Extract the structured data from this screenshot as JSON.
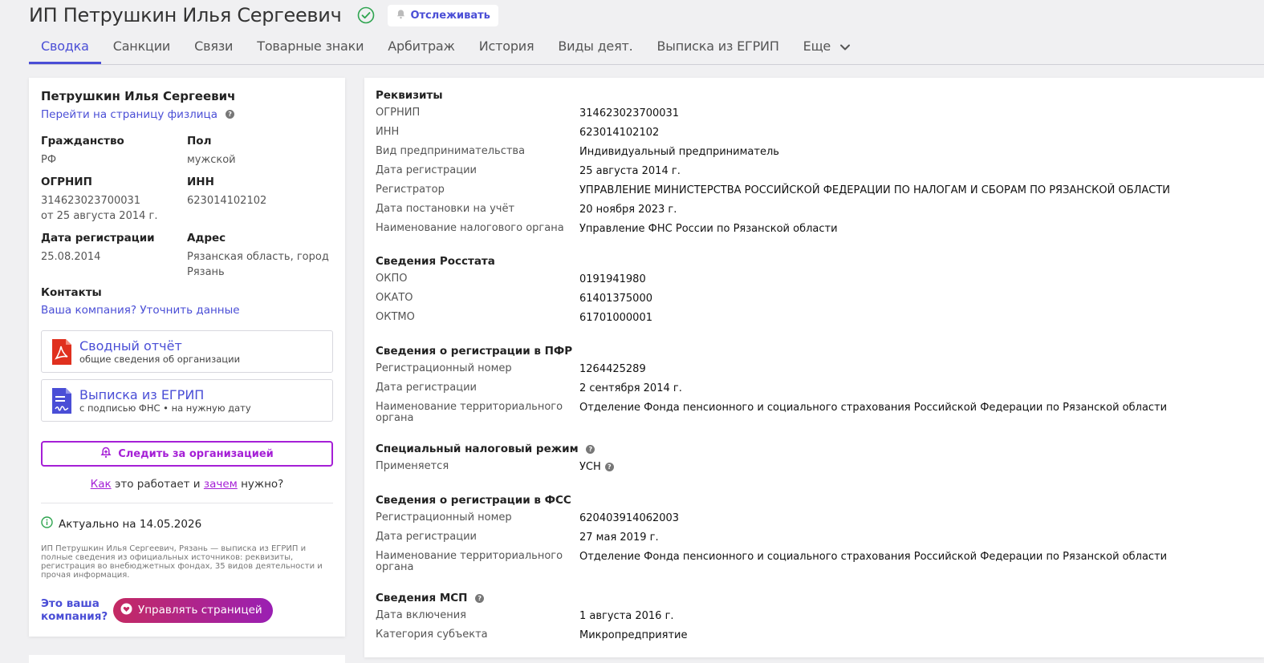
{
  "header": {
    "title": "ИП Петрушкин Илья Сергеевич",
    "track_label": "Отслеживать"
  },
  "tabs": [
    {
      "label": "Сводка"
    },
    {
      "label": "Санкции"
    },
    {
      "label": "Связи"
    },
    {
      "label": "Товарные знаки"
    },
    {
      "label": "Арбитраж"
    },
    {
      "label": "История"
    },
    {
      "label": "Виды деят."
    },
    {
      "label": "Выписка из ЕГРИП"
    },
    {
      "label": "Еще"
    }
  ],
  "left": {
    "name": "Петрушкин Илья Сергеевич",
    "person_link": "Перейти на страницу физлица",
    "citizenship_label": "Гражданство",
    "citizenship": "РФ",
    "sex_label": "Пол",
    "sex": "мужской",
    "ogrnip_label": "ОГРНИП",
    "ogrnip": "314623023700031",
    "ogrnip_date": "от 25 августа 2014 г.",
    "inn_label": "ИНН",
    "inn": "623014102102",
    "regdate_label": "Дата регистрации",
    "regdate": "25.08.2014",
    "address_label": "Адрес",
    "address_line1": "Рязанская область, город",
    "address_line2": "Рязань",
    "contacts_label": "Контакты",
    "contacts_link": "Ваша компания? Уточнить данные",
    "report_title": "Сводный отчёт",
    "report_sub": "общие сведения об организации",
    "egrip_title": "Выписка из ЕГРИП",
    "egrip_sub": "с подписью ФНС • на нужную дату",
    "follow_label": "Следить за организацией",
    "how_1": "Как",
    "how_2": " это работает и ",
    "how_3": "зачем",
    "how_4": " нужно?",
    "actual": "Актуально на 14.05.2026",
    "description": "ИП Петрушкин Илья Сергеевич, Рязань — выписка из ЕГРИП и полные сведения из официальных источников: реквизиты, регистрация во внебюджетных фондах, 35 видов деятельности и прочая информация.",
    "your_company": "Это ваша компания?",
    "manage_label": "Управлять страницей"
  },
  "right": {
    "req_title": "Реквизиты",
    "req": [
      {
        "k": "ОГРНИП",
        "v": "314623023700031"
      },
      {
        "k": "ИНН",
        "v": "623014102102"
      },
      {
        "k": "Вид предпринимательства",
        "v": "Индивидуальный предприниматель"
      },
      {
        "k": "Дата регистрации",
        "v": "25 августа 2014 г."
      },
      {
        "k": "Регистратор",
        "v": "УПРАВЛЕНИЕ МИНИСТЕРСТВА РОССИЙСКОЙ ФЕДЕРАЦИИ ПО НАЛОГАМ И СБОРАМ ПО РЯЗАНСКОЙ ОБЛАСТИ"
      },
      {
        "k": "Дата постановки на учёт",
        "v": "20 ноября 2023 г."
      },
      {
        "k": "Наименование налогового органа",
        "v": "Управление ФНС России по Рязанской области"
      }
    ],
    "rosstat_title": "Сведения Росстата",
    "rosstat": [
      {
        "k": "ОКПО",
        "v": "0191941980"
      },
      {
        "k": "ОКАТО",
        "v": "61401375000"
      },
      {
        "k": "ОКТМО",
        "v": "61701000001"
      }
    ],
    "pfr_title": "Сведения о регистрации в ПФР",
    "pfr": [
      {
        "k": "Регистрационный номер",
        "v": "1264425289"
      },
      {
        "k": "Дата регистрации",
        "v": "2 сентября 2014 г."
      },
      {
        "k": "Наименование территориального органа",
        "v": "Отделение Фонда пенсионного и социального страхования Российской Федерации по Рязанской области"
      }
    ],
    "tax_title": "Специальный налоговый режим",
    "tax": [
      {
        "k": "Применяется",
        "v": "УСН"
      }
    ],
    "fss_title": "Сведения о регистрации в ФСС",
    "fss": [
      {
        "k": "Регистрационный номер",
        "v": "620403914062003"
      },
      {
        "k": "Дата регистрации",
        "v": "27 мая 2019 г."
      },
      {
        "k": "Наименование территориального органа",
        "v": "Отделение Фонда пенсионного и социального страхования Российской Федерации по Рязанской области"
      }
    ],
    "msp_title": "Сведения МСП",
    "msp": [
      {
        "k": "Дата включения",
        "v": "1 августа 2016 г."
      },
      {
        "k": "Категория субъекта",
        "v": "Микропредприятие"
      }
    ]
  },
  "colors": {
    "accent": "#4a4ed6",
    "follow": "#a51fd6",
    "verified": "#2ea44f",
    "pdf_red": "#e0301e"
  }
}
